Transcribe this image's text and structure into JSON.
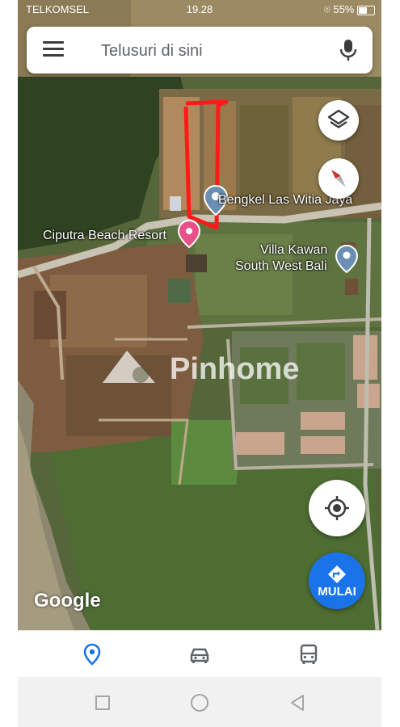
{
  "status_bar": {
    "carrier": "TELKOMSEL",
    "time": "19.28",
    "battery": "55%"
  },
  "search": {
    "placeholder": "Telusuri di sini"
  },
  "map": {
    "places": [
      {
        "name": "Bengkel Las Witia Jaya"
      },
      {
        "name": "Ciputra Beach Resort"
      },
      {
        "name": "Villa Kawan"
      },
      {
        "name": "South West Bali"
      }
    ],
    "logo": "Google",
    "watermark": "Pinhome"
  },
  "actions": {
    "directions_label": "MULAI"
  },
  "icons": {
    "menu": "menu-icon",
    "mic": "mic-icon",
    "layers": "layers-icon",
    "compass": "compass-icon",
    "my_location": "my-location-icon",
    "directions": "directions-icon",
    "explore": "location-pin-icon",
    "driving": "car-icon",
    "transit": "bus-icon"
  },
  "colors": {
    "accent": "#1a73e8",
    "annotation": "#ff1a1a",
    "place_pin": "#6b8fb3",
    "resort_pin": "#e8508a"
  }
}
